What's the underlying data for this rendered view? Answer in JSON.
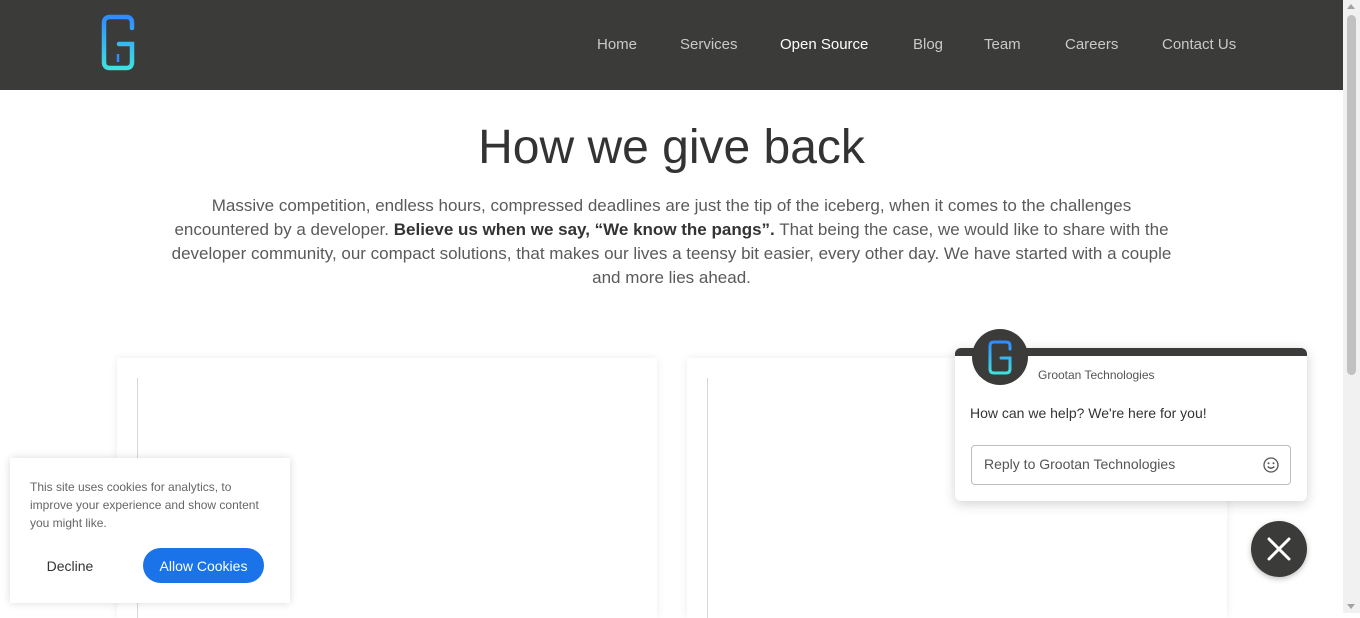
{
  "brand": {
    "logo_letter": "G",
    "accent_from": "#2f8cff",
    "accent_to": "#3fe0e0"
  },
  "nav": {
    "items": [
      {
        "label": "Home",
        "active": false
      },
      {
        "label": "Services",
        "active": false
      },
      {
        "label": "Open Source",
        "active": true
      },
      {
        "label": "Blog",
        "active": false
      },
      {
        "label": "Team",
        "active": false
      },
      {
        "label": "Careers",
        "active": false
      },
      {
        "label": "Contact Us",
        "active": false
      }
    ]
  },
  "hero": {
    "title": "How we give back",
    "intro_part1": "Massive competition, endless hours, compressed deadlines are just the tip of the iceberg, when it comes to the challenges encountered by a developer. ",
    "intro_bold": "Believe us when we say, “We know the pangs”.",
    "intro_part2": " That being the case, we would like to share with the developer community, our compact solutions, that makes our lives a teensy bit easier, every other day. We have started with a couple and more lies ahead."
  },
  "chat": {
    "company": "Grootan Technologies",
    "message": "How can we help? We're here for you!",
    "reply_placeholder": "Reply to Grootan Technologies",
    "emoji_icon": "smiley-icon",
    "close_icon": "close-icon"
  },
  "cookie_banner": {
    "text": "This site uses cookies for analytics, to improve your experience and show content you might like.",
    "decline_label": "Decline",
    "allow_label": "Allow Cookies",
    "allow_color": "#1a73e8"
  },
  "colors": {
    "header_bg": "#3b3b39",
    "nav_text": "#c9c9c9",
    "nav_active": "#ffffff"
  }
}
